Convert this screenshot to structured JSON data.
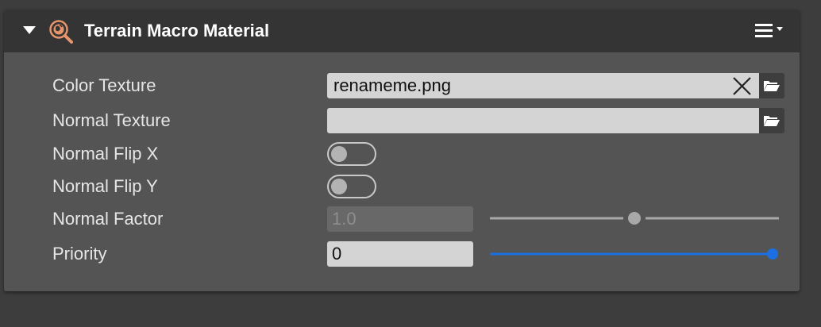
{
  "component": {
    "title": "Terrain Macro Material",
    "icon": "terrain-globe-search-icon",
    "menu_icon": "hamburger-menu-icon"
  },
  "properties": {
    "color_texture": {
      "label": "Color Texture",
      "value": "renameme.png"
    },
    "normal_texture": {
      "label": "Normal Texture",
      "value": ""
    },
    "normal_flip_x": {
      "label": "Normal Flip X",
      "checked": false
    },
    "normal_flip_y": {
      "label": "Normal Flip Y",
      "checked": false
    },
    "normal_factor": {
      "label": "Normal Factor",
      "value": "1.0",
      "slider_fraction": 0.5,
      "disabled": true
    },
    "priority": {
      "label": "Priority",
      "value": "0",
      "slider_fraction": 1.0,
      "disabled": false
    }
  },
  "colors": {
    "slider_active": "#1c6fe0",
    "slider_disabled": "#a8a8a8",
    "icon_accent": "#e8956b"
  }
}
